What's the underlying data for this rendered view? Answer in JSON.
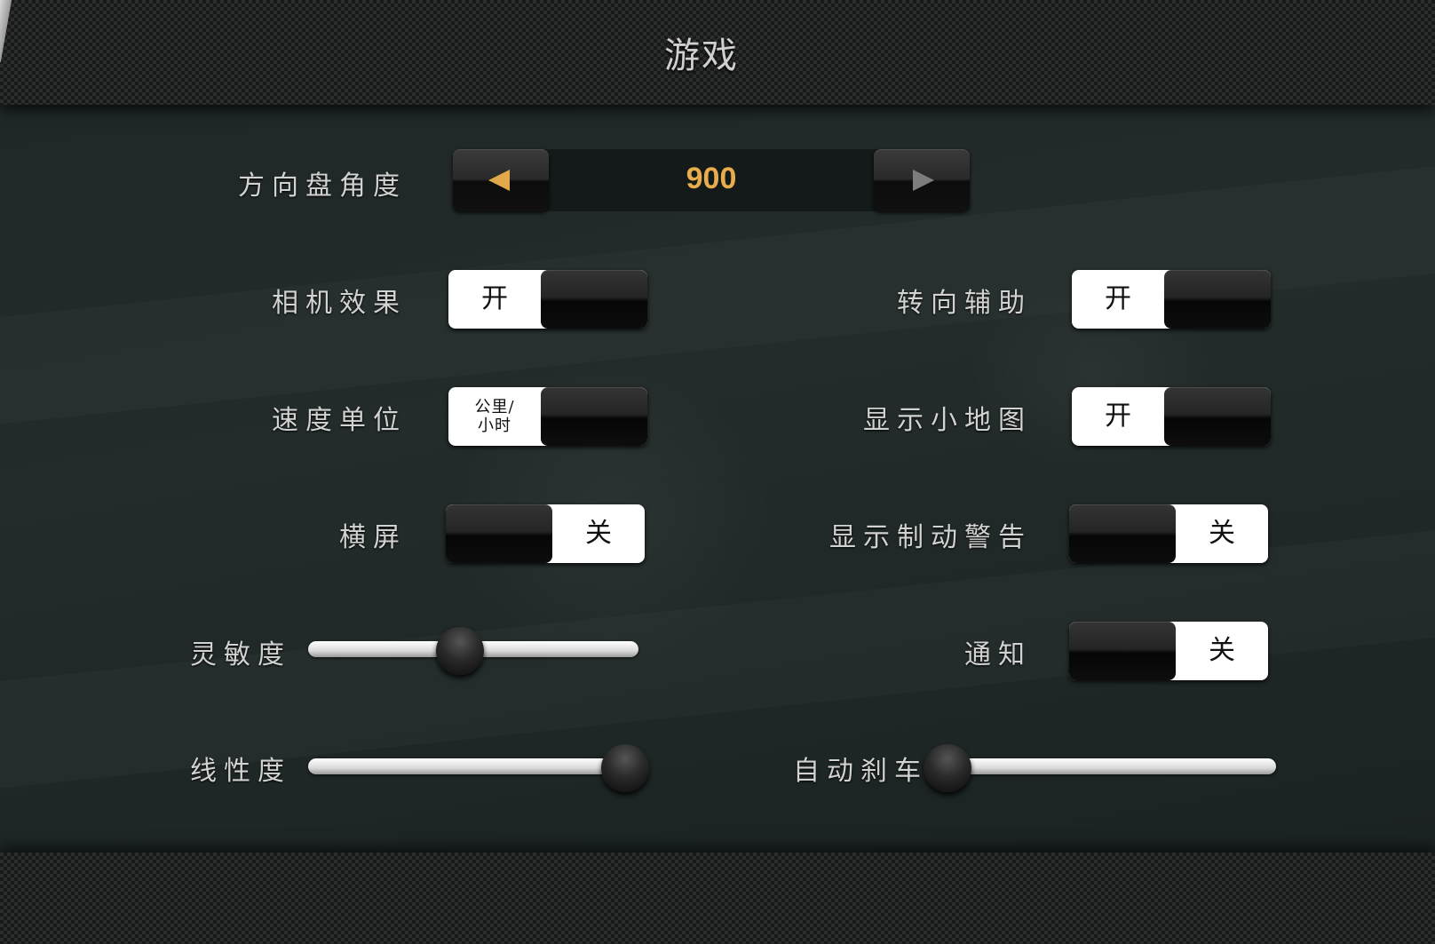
{
  "header": {
    "title": "游戏"
  },
  "steering_angle": {
    "label": "方向盘角度",
    "value": "900"
  },
  "toggles": {
    "camera_effect": {
      "label": "相机效果",
      "state_label": "开",
      "on": true
    },
    "steering_assist": {
      "label": "转向辅助",
      "state_label": "开",
      "on": true
    },
    "speed_unit": {
      "label": "速度单位",
      "state_label_line1": "公里/",
      "state_label_line2": "小时",
      "on": true
    },
    "show_minimap": {
      "label": "显示小地图",
      "state_label": "开",
      "on": true
    },
    "landscape": {
      "label": "横屏",
      "state_label": "关",
      "on": false
    },
    "brake_warning": {
      "label": "显示制动警告",
      "state_label": "关",
      "on": false
    },
    "notifications": {
      "label": "通知",
      "state_label": "关",
      "on": false
    }
  },
  "sliders": {
    "sensitivity": {
      "label": "灵敏度",
      "value": 0.46
    },
    "linearity": {
      "label": "线性度",
      "value": 0.96
    },
    "auto_brake": {
      "label": "自动刹车",
      "value": 0.04
    }
  },
  "colors": {
    "accent": "#e7ad4c",
    "arrow_inactive": "#7d7d7d"
  }
}
